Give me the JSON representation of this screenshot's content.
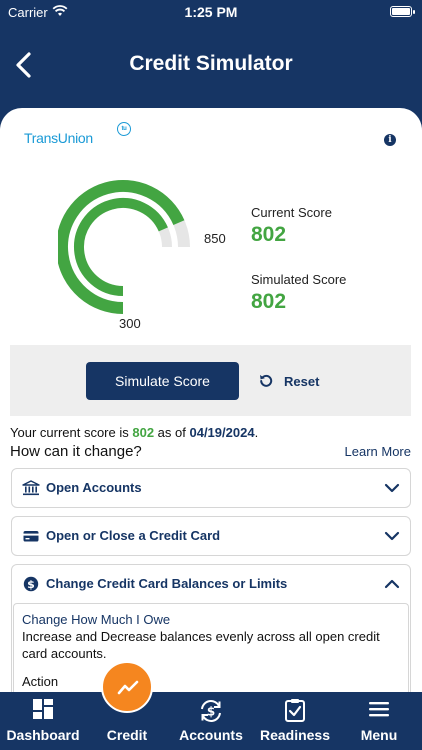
{
  "status_bar": {
    "carrier": "Carrier",
    "time": "1:25 PM"
  },
  "nav": {
    "title": "Credit Simulator",
    "back_icon": "chevron-left-icon"
  },
  "bureau": {
    "logo_text": "TransUnion",
    "badge": "tu",
    "logo_color": "#1a9ad6"
  },
  "gauge": {
    "min_label": "300",
    "max_label": "850",
    "min": 300,
    "max": 850,
    "current": 802,
    "simulated": 802,
    "color": "#43a542",
    "track_color": "#e6e6e6"
  },
  "scores": {
    "current_label": "Current Score",
    "current_value": "802",
    "simulated_label": "Simulated Score",
    "simulated_value": "802"
  },
  "actions": {
    "simulate_label": "Simulate Score",
    "reset_label": "Reset"
  },
  "summary": {
    "prefix": "Your current score is ",
    "score": "802",
    "mid": " as of ",
    "date": "04/19/2024",
    "suffix": ".",
    "question": "How can it change?",
    "learn_more": "Learn More"
  },
  "accordions": [
    {
      "title": "Open Accounts",
      "icon": "bank-icon",
      "expanded": false
    },
    {
      "title": "Open or Close a Credit Card",
      "icon": "credit-card-icon",
      "expanded": false
    },
    {
      "title": "Change Credit Card Balances or Limits",
      "icon": "dollar-icon",
      "expanded": true
    }
  ],
  "expanded_body": {
    "subtitle": "Change How Much I Owe",
    "description": "Increase and Decrease balances evenly across all open credit card accounts.",
    "action_label": "Action"
  },
  "tabs": [
    {
      "label": "Dashboard",
      "icon": "dashboard-icon"
    },
    {
      "label": "Credit",
      "icon": "trend-line-icon"
    },
    {
      "label": "Accounts",
      "icon": "dollar-sync-icon"
    },
    {
      "label": "Readiness",
      "icon": "clipboard-check-icon"
    },
    {
      "label": "Menu",
      "icon": "hamburger-icon"
    }
  ],
  "colors": {
    "navy": "#163564",
    "green": "#43a542",
    "orange": "#f5861f",
    "panel": "#eeeeee"
  }
}
